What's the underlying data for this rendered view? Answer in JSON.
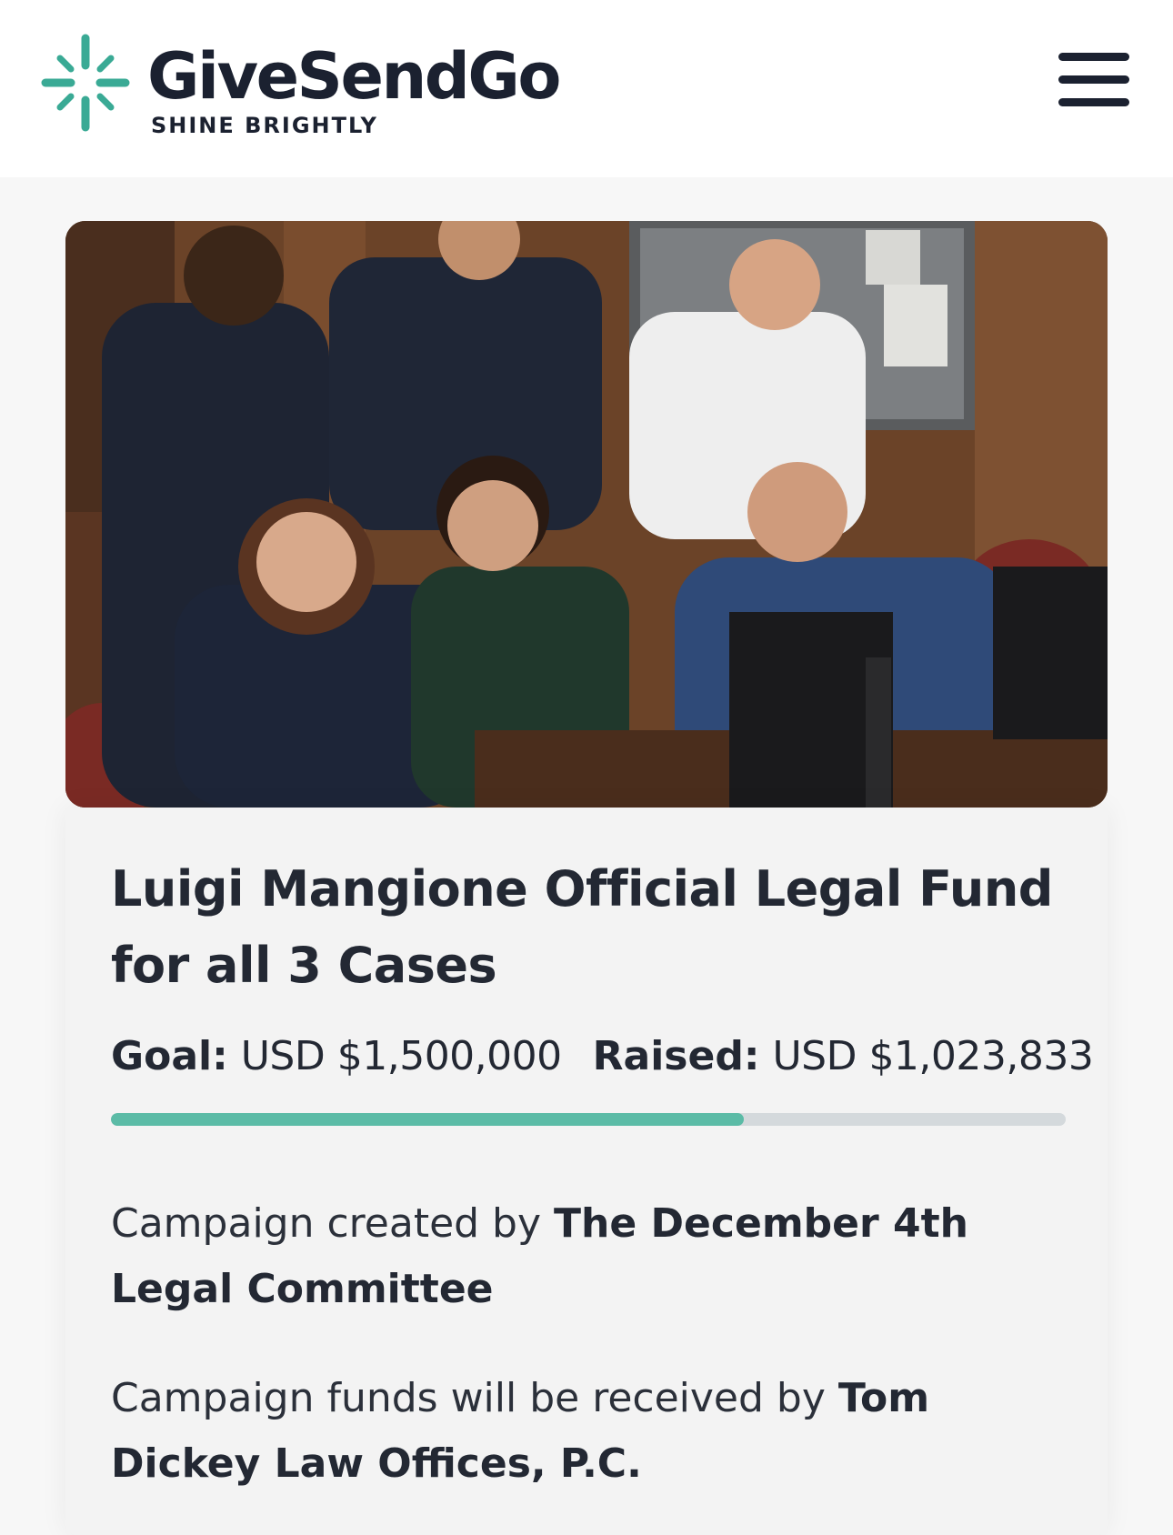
{
  "header": {
    "brand_name": "GiveSendGo",
    "tagline": "SHINE BRIGHTLY",
    "menu_icon": "hamburger-menu-icon"
  },
  "colors": {
    "brand_teal": "#3aaa95",
    "progress_fill": "#5bbba6",
    "progress_track": "#d4d9dc",
    "text_dark": "#232833"
  },
  "campaign": {
    "title": "Luigi Mangione Official Legal Fund for all 3 Cases",
    "goal_label": "Goal:",
    "goal_value": "USD $1,500,000",
    "raised_label": "Raised:",
    "raised_value": "USD $1,023,833",
    "progress_fraction": 0.663,
    "created_by_prefix": "Campaign created by",
    "created_by": "The December 4th Legal Committee",
    "recipient_prefix": "Campaign funds will be received by",
    "recipient": "Tom Dickey Law Offices, P.C."
  }
}
